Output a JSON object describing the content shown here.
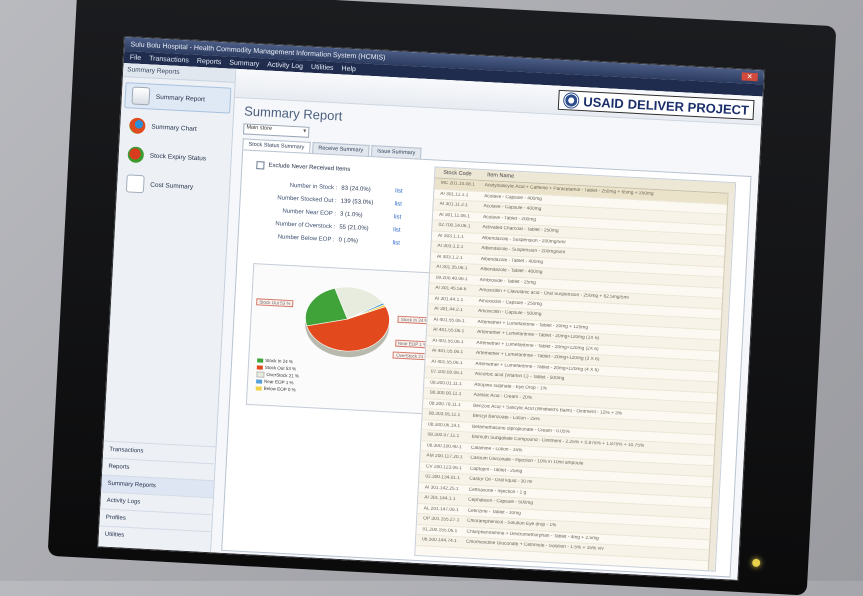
{
  "window": {
    "title": "Sulu Bolu Hospital - Health Commodity Management Information System (HCMIS)",
    "menu": [
      "File",
      "Transactions",
      "Reports",
      "Summary",
      "Activity Log",
      "Utilities",
      "Help"
    ]
  },
  "left": {
    "header": "Summary Reports",
    "items": [
      {
        "label": "Summary Report",
        "icon": "report-icon"
      },
      {
        "label": "Summary Chart",
        "icon": "chart-icon"
      },
      {
        "label": "Stock Expiry Status",
        "icon": "expiry-icon"
      },
      {
        "label": "Cost Summary",
        "icon": "cost-icon"
      }
    ],
    "bottom_tabs": [
      "Transactions",
      "Reports",
      "Summary Reports",
      "Activity Logs",
      "Profiles",
      "Utilities"
    ]
  },
  "brand": {
    "logo_text": "USAID",
    "deliver": "DELIVER PROJECT"
  },
  "main": {
    "title": "Summary Report",
    "combo_value": "Main store",
    "tabs": [
      "Stock Status Summary",
      "Receive Summary",
      "Issue Summary"
    ],
    "exclude_label": "Exclude Never Received Items",
    "stats": [
      {
        "label": "Number in Stock :",
        "value": "83 (24.0%)",
        "link": "list"
      },
      {
        "label": "Number Stocked Out :",
        "value": "139 (53.0%)",
        "link": "list"
      },
      {
        "label": "Number Near EOP :",
        "value": "3 (1.0%)",
        "link": "list"
      },
      {
        "label": "Number of Overstock :",
        "value": "55 (21.0%)",
        "link": "list"
      },
      {
        "label": "Number Below EOP :",
        "value": "0 (.0%)",
        "link": "list"
      }
    ]
  },
  "chart_data": {
    "type": "pie",
    "slices": [
      {
        "name": "Stock Out 53 %",
        "value": 53,
        "color": "#e24a1e"
      },
      {
        "name": "Stock In 24 %",
        "value": 24,
        "color": "#3fa33a"
      },
      {
        "name": "OverStock 21 %",
        "value": 21,
        "color": "#e8ecde"
      },
      {
        "name": "Near EOP 1 %",
        "value": 1,
        "color": "#5aa0d8"
      },
      {
        "name": "Below EOP 0 %",
        "value": 1,
        "color": "#f0d24a"
      }
    ],
    "callouts": [
      "Stock Out 53 %",
      "Stock In 24 %",
      "Near EOP 1 %",
      "OverStock 21 %"
    ],
    "legend": [
      "Stock In 24 %",
      "Stock Out 53 %",
      "OverStock 21 %",
      "Near EOP 1 %",
      "Below EOP 0 %"
    ]
  },
  "grid": {
    "headers": [
      "Stock Code",
      "Item Name"
    ],
    "rows": [
      {
        "code": "MC 201.10.08.1",
        "name": "Acetylsalicylic Acid + Caffeine + Paracetamol - Tablet - 250mg + 65mg + 250mg"
      },
      {
        "code": "AI 301.11.1.1",
        "name": "Acolave - Capsule - 400mg"
      },
      {
        "code": "AI 301.11.2.1",
        "name": "Acolave - Capsule - 400mg"
      },
      {
        "code": "AI 301.11.06.1",
        "name": "Acolave - Tablet - 200mg"
      },
      {
        "code": "02.700.14.06.1",
        "name": "Activated Charcoal - Tablet - 250mg"
      },
      {
        "code": "AI 303.1.1.1",
        "name": "Albendazole - Suspension - 200mg/5ml"
      },
      {
        "code": "AI 303.1.2.1",
        "name": "Albendazole - Suspension - 200mg/5ml"
      },
      {
        "code": "AI 303.1.2.1",
        "name": "Albendazole - Tablet - 400mg"
      },
      {
        "code": "AI 301.35.06.1",
        "name": "Albendazole - Tablet - 400mg"
      },
      {
        "code": "09.200.40.06.1",
        "name": "Ambroxide - Tablet - 25mg"
      },
      {
        "code": "AI 301.45.58.6",
        "name": "Amoxicillin + Clavulanic acid - Oral Suspension - 250mg + 62.5mg/5ml"
      },
      {
        "code": "AI 301.44.1.1",
        "name": "Amoxicillin - Capsule - 250mg"
      },
      {
        "code": "AI 301.44.2.1",
        "name": "Amoxicillin - Capsule - 500mg"
      },
      {
        "code": "AI 401.55.06.1",
        "name": "Artemether + Lumefantrine - Tablet - 20mg + 120mg"
      },
      {
        "code": "AI 401.55.06.1",
        "name": "Artemether + Lumefantrine - Tablet - 20mg+120mg (1X 6)"
      },
      {
        "code": "AI 401.55.06.1",
        "name": "Artemether + Lumefantrine - Tablet - 20mg+120mg (2X 6)"
      },
      {
        "code": "AI 401.55.06.1",
        "name": "Artemether + Lumefantrine - Tablet - 20mg+120mg (3 X 6)"
      },
      {
        "code": "AI 401.55.06.1",
        "name": "Artemether + Lumefantrine - Tablet - 20mg+120mg (4 X 6)"
      },
      {
        "code": "07.100.00.06.1",
        "name": "Ascorbic acid (Vitamin C) - Tablet - 500mg"
      },
      {
        "code": "08.200.01.11.1",
        "name": "Atropine sulphate - Eye Drop - 1%"
      },
      {
        "code": "08.300.00.11.1",
        "name": "Azelaic Acid - Cream - 20%"
      },
      {
        "code": "08.300.79.11.1",
        "name": "Benzoic Acid + Salicylic Acid (Whitfield's Balm) - Ointment - 12% + 3%"
      },
      {
        "code": "08.303.05.11.1",
        "name": "Benzyl Benzoate - Lotion - 25%"
      },
      {
        "code": "08.300.06.19.1",
        "name": "Betamethasone dipropionate - Cream - 0.05%"
      },
      {
        "code": "08.300.07.11.1",
        "name": "Bismuth Subgallate Compound - Ointment - 2.25% + 0.875% + 1.875% + 10.75%"
      },
      {
        "code": "08.300.100.40.1",
        "name": "Calamine - Lotion - 15%"
      },
      {
        "code": "AM 200.117.20.1",
        "name": "Calcium Gluconate - Injection - 10% in 10ml ampoule"
      },
      {
        "code": "CV 200.123.06.1",
        "name": "Captopril - Tablet - 25mg"
      },
      {
        "code": "02.300.134.01.1",
        "name": "Castor Oil - Oral liquid - 30 ml"
      },
      {
        "code": "AI 301.142.25.1",
        "name": "Ceftriaxone - Injection - 1 g"
      },
      {
        "code": "AI 301.144.1.1",
        "name": "Cephalexin - Capsule - 500mg"
      },
      {
        "code": "AL 201.147.06.1",
        "name": "Cetirizine - Tablet - 10mg"
      },
      {
        "code": "OP 301.155.27.1",
        "name": "Chloramphenicol - Solution Eye drop - 1%"
      },
      {
        "code": "01.200.155.06.1",
        "name": "Chlorpheniramine + Dextromethorphan - Tablet - 4mg + 2.5mg"
      },
      {
        "code": "08.300.144.74.1",
        "name": "Chlorhexidine Gluconate + Cetrimide - Solution - 1.5% + 15% v/v"
      }
    ]
  }
}
